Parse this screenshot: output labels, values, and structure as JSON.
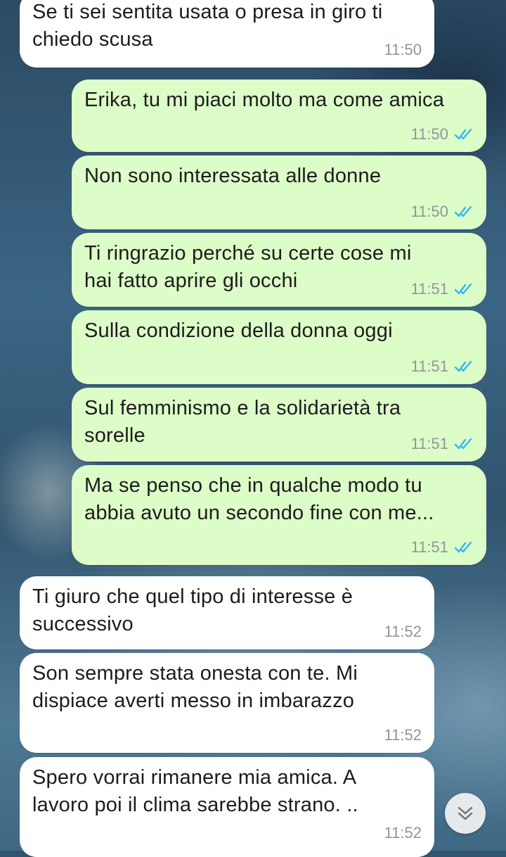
{
  "colors": {
    "incoming_bubble": "#ffffff",
    "outgoing_bubble": "#ddfdc8",
    "read_tick": "#34b7f1",
    "timestamp": "#8f959a"
  },
  "messages": [
    {
      "direction": "incoming",
      "text": "Se ti sei sentita usata o presa in giro ti\nchiedo scusa",
      "time": "11:50"
    },
    {
      "direction": "outgoing",
      "text": "Erika, tu mi piaci molto ma come amica",
      "time": "11:50",
      "status": "read-double-tick-icon"
    },
    {
      "direction": "outgoing",
      "text": "Non sono interessata alle donne",
      "time": "11:50",
      "status": "read-double-tick-icon"
    },
    {
      "direction": "outgoing",
      "text": "Ti ringrazio perché su certe cose mi\nhai fatto aprire gli occhi",
      "time": "11:51",
      "status": "read-double-tick-icon"
    },
    {
      "direction": "outgoing",
      "text": "Sulla condizione della donna oggi",
      "time": "11:51",
      "status": "read-double-tick-icon"
    },
    {
      "direction": "outgoing",
      "text": "Sul femminismo e la solidarietà tra\nsorelle",
      "time": "11:51",
      "status": "read-double-tick-icon"
    },
    {
      "direction": "outgoing",
      "text": "Ma se penso che in qualche modo tu\nabbia avuto un secondo fine con me...",
      "time": "11:51",
      "status": "read-double-tick-icon"
    },
    {
      "direction": "incoming",
      "text": "Ti giuro che quel tipo di interesse è\nsuccessivo",
      "time": "11:52"
    },
    {
      "direction": "incoming",
      "text": "Son sempre stata onesta con te. Mi\ndispiace averti messo in imbarazzo",
      "time": "11:52"
    },
    {
      "direction": "incoming",
      "text": "Spero vorrai rimanere mia amica. A\nlavoro poi il clima sarebbe strano. ..",
      "time": "11:52"
    }
  ],
  "scroll_button": {
    "icon": "double-chevron-down-icon"
  }
}
